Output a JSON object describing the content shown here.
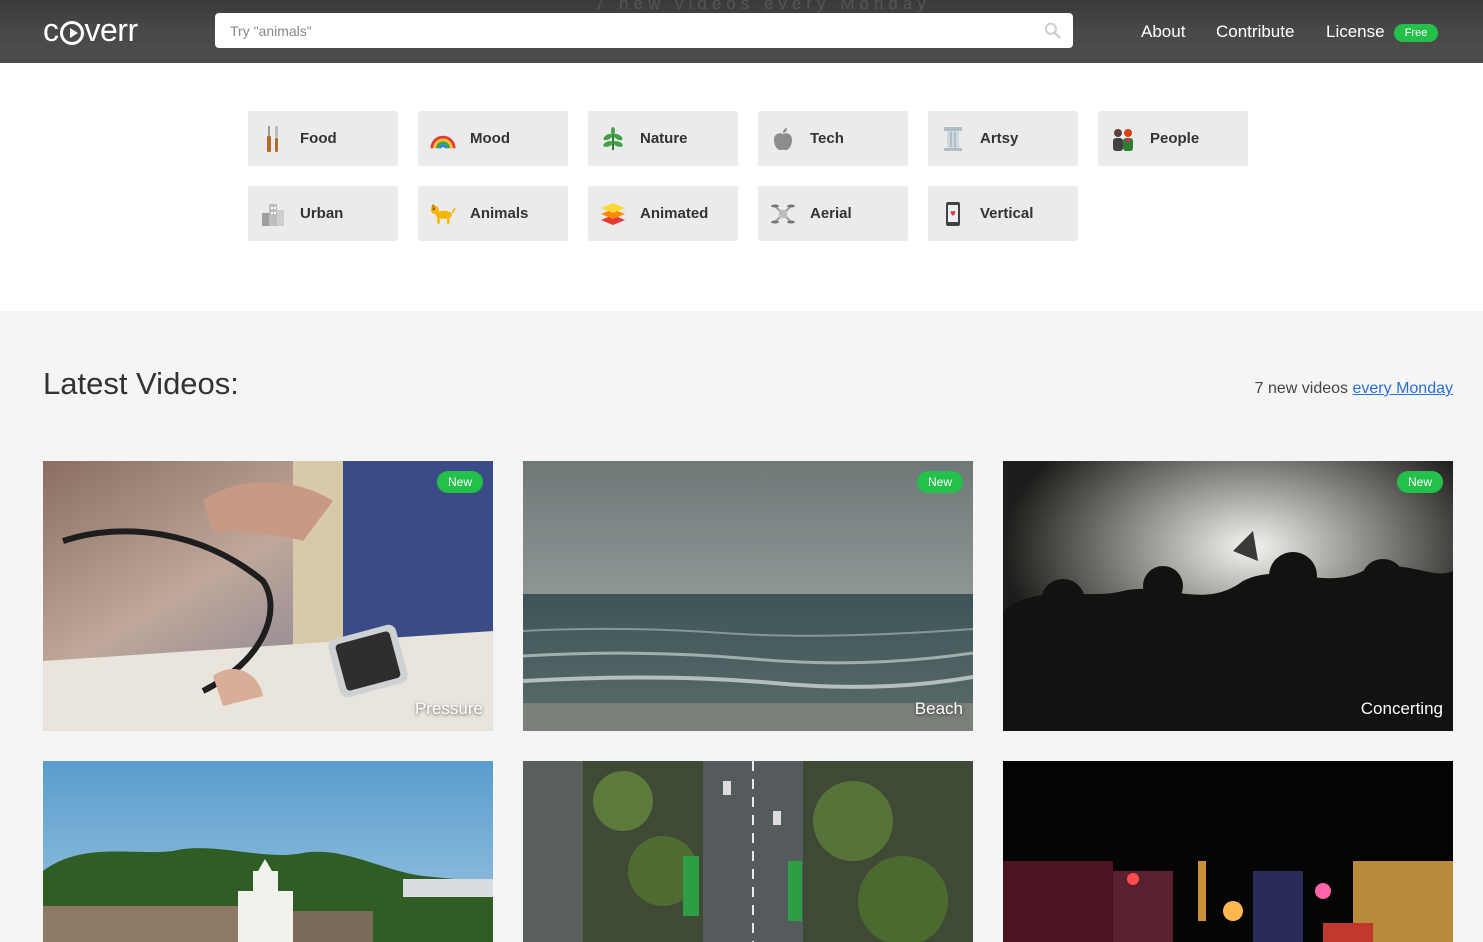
{
  "header": {
    "logo": "coverr",
    "background_text": "7 new videos every Monday",
    "search_placeholder": "Try \"animals\"",
    "nav": {
      "about": "About",
      "contribute": "Contribute",
      "license": "License",
      "license_badge": "Free"
    }
  },
  "categories": [
    {
      "label": "Food",
      "icon": "fork-knife-icon"
    },
    {
      "label": "Mood",
      "icon": "rainbow-icon"
    },
    {
      "label": "Nature",
      "icon": "herb-icon"
    },
    {
      "label": "Tech",
      "icon": "apple-icon"
    },
    {
      "label": "Artsy",
      "icon": "column-icon"
    },
    {
      "label": "People",
      "icon": "people-icon"
    },
    {
      "label": "Urban",
      "icon": "buildings-icon"
    },
    {
      "label": "Animals",
      "icon": "dog-icon"
    },
    {
      "label": "Animated",
      "icon": "layers-icon"
    },
    {
      "label": "Aerial",
      "icon": "drone-icon"
    },
    {
      "label": "Vertical",
      "icon": "phone-icon"
    }
  ],
  "latest": {
    "title": "Latest Videos:",
    "subtitle_prefix": "7 new videos",
    "subtitle_link": "every Monday",
    "new_badge": "New",
    "videos": [
      {
        "caption": "Pressure",
        "is_new": true
      },
      {
        "caption": "Beach",
        "is_new": true
      },
      {
        "caption": "Concerting",
        "is_new": true
      },
      {
        "caption": "",
        "is_new": false
      },
      {
        "caption": "",
        "is_new": false
      },
      {
        "caption": "",
        "is_new": false
      }
    ]
  },
  "colors": {
    "accent_green": "#23c14a",
    "link_blue": "#2a6fd6",
    "header_bg": "#444444",
    "tile_bg": "#ebebeb"
  }
}
